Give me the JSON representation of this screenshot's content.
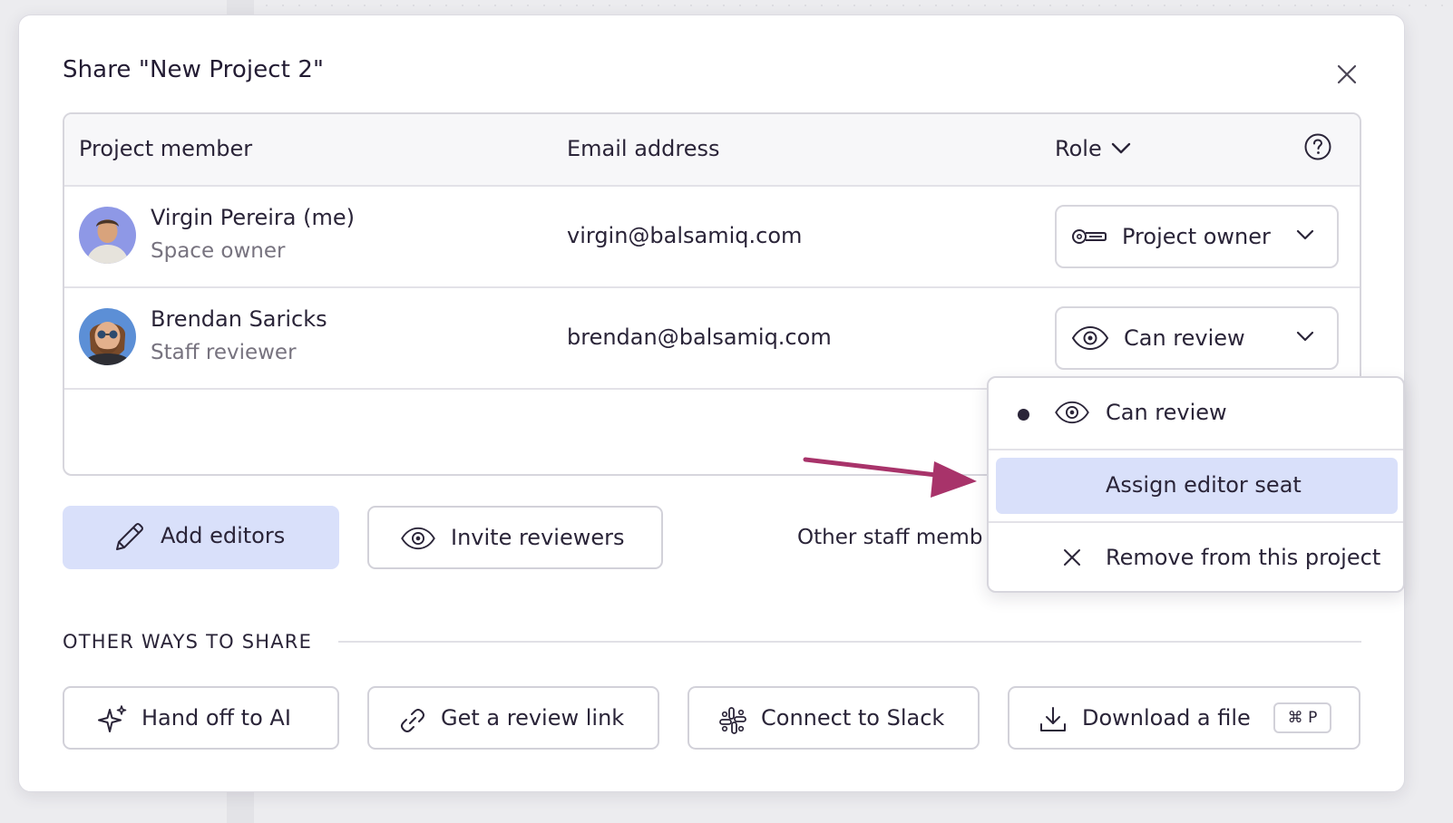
{
  "dialog": {
    "title": "Share \"New Project 2\"",
    "close_icon": "close-icon"
  },
  "table": {
    "headers": {
      "member": "Project member",
      "email": "Email address",
      "role": "Role"
    },
    "help_icon": "question-circle-icon",
    "rows": [
      {
        "name": "Virgin Pereira (me)",
        "subtitle": "Space owner",
        "email": "virgin@balsamiq.com",
        "role": "Project owner",
        "role_icon": "key-icon"
      },
      {
        "name": "Brendan Saricks",
        "subtitle": "Staff reviewer",
        "email": "brendan@balsamiq.com",
        "role": "Can review",
        "role_icon": "eye-icon"
      }
    ]
  },
  "actions": {
    "add_editors": "Add editors",
    "invite_reviewers": "Invite reviewers",
    "other_staff": "Other staff memb"
  },
  "role_menu": {
    "items": [
      {
        "label": "Can review",
        "selected": true,
        "icon": "eye-icon"
      },
      {
        "label": "Assign editor seat",
        "highlighted": true
      },
      {
        "label": "Remove from this project",
        "icon": "close-icon"
      }
    ]
  },
  "other_ways": {
    "title": "OTHER WAYS TO SHARE",
    "buttons": [
      {
        "label": "Hand off to AI",
        "icon": "sparkle-icon"
      },
      {
        "label": "Get a review link",
        "icon": "link-icon"
      },
      {
        "label": "Connect to Slack",
        "icon": "slack-icon"
      },
      {
        "label": "Download a file",
        "icon": "download-icon",
        "shortcut": "⌘ P"
      }
    ]
  },
  "colors": {
    "primary_button_bg": "#d9e0fa",
    "highlight_bg": "#d9e0fa",
    "arrow": "#a8336a",
    "text": "#2a2438"
  }
}
